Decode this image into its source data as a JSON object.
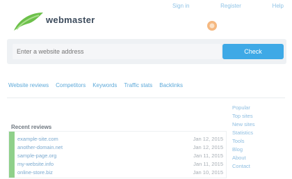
{
  "header": {
    "logo_text": "webmaster",
    "top_links": [
      "Sign in",
      "Register",
      "Help"
    ]
  },
  "search": {
    "placeholder": "Enter a website address",
    "button_label": "Check"
  },
  "nav": {
    "items": [
      "Website reviews",
      "Competitors",
      "Keywords",
      "Traffic stats",
      "Backlinks"
    ]
  },
  "content": {
    "section_title": "Recent reviews",
    "rows": [
      {
        "title": "example-site.com",
        "meta": "Jan 12, 2015"
      },
      {
        "title": "another-domain.net",
        "meta": "Jan 12, 2015"
      },
      {
        "title": "sample-page.org",
        "meta": "Jan 11, 2015"
      },
      {
        "title": "my-website.info",
        "meta": "Jan 11, 2015"
      },
      {
        "title": "online-store.biz",
        "meta": "Jan 10, 2015"
      }
    ]
  },
  "sidebar": {
    "items": [
      "Popular",
      "Top sites",
      "New sites",
      "Statistics",
      "Tools",
      "Blog",
      "About",
      "Contact"
    ]
  },
  "colors": {
    "accent": "#3ea9e6",
    "logo_green": "#6cc04a",
    "link": "#5da9d9"
  }
}
